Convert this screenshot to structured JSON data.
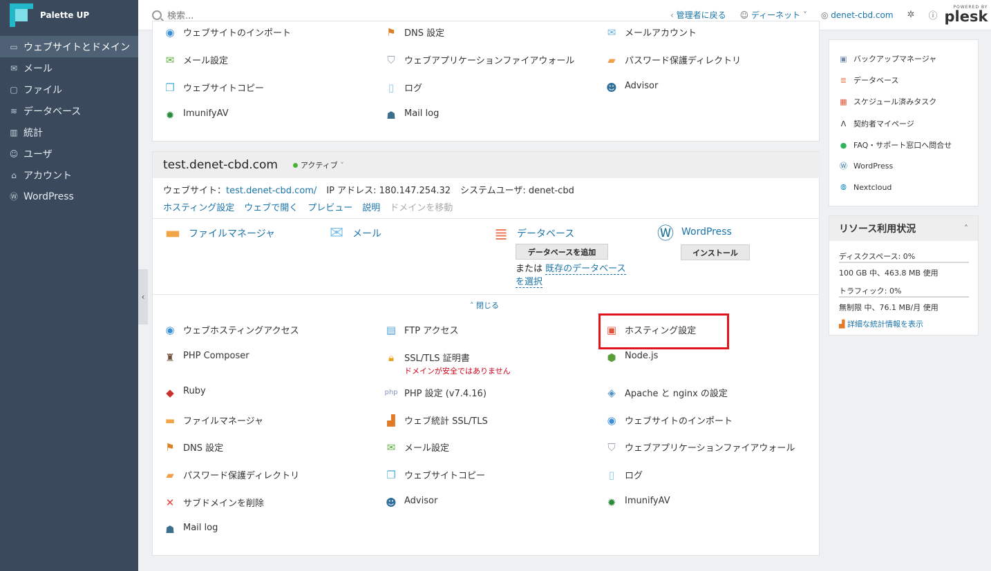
{
  "app": {
    "title": "Palette UP"
  },
  "sidebar": {
    "items": [
      {
        "label": "ウェブサイトとドメイン",
        "icon": "monitor-icon"
      },
      {
        "label": "メール",
        "icon": "mail-icon"
      },
      {
        "label": "ファイル",
        "icon": "folder-icon"
      },
      {
        "label": "データベース",
        "icon": "database-icon"
      },
      {
        "label": "統計",
        "icon": "chart-icon"
      },
      {
        "label": "ユーザ",
        "icon": "user-icon"
      },
      {
        "label": "アカウント",
        "icon": "account-icon"
      },
      {
        "label": "WordPress",
        "icon": "wordpress-icon"
      }
    ]
  },
  "topbar": {
    "search_placeholder": "検索...",
    "back_admin": "管理者に戻る",
    "user": "ディーネット",
    "domain": "denet-cbd.com",
    "powered_by": "POWERED BY",
    "brand": "plesk"
  },
  "top_tools": [
    {
      "label": "ウェブサイトのインポート",
      "icon": "globe-import-icon"
    },
    {
      "label": "DNS 設定",
      "icon": "dns-icon"
    },
    {
      "label": "メールアカウント",
      "icon": "mail-account-icon"
    },
    {
      "label": "メール設定",
      "icon": "mail-settings-icon"
    },
    {
      "label": "ウェブアプリケーションファイアウォール",
      "icon": "shield-icon"
    },
    {
      "label": "パスワード保護ディレクトリ",
      "icon": "lock-folder-icon"
    },
    {
      "label": "ウェブサイトコピー",
      "icon": "copy-icon"
    },
    {
      "label": "ログ",
      "icon": "log-icon"
    },
    {
      "label": "Advisor",
      "icon": "advisor-icon"
    },
    {
      "label": "ImunifyAV",
      "icon": "imunify-icon"
    },
    {
      "label": "Mail log",
      "icon": "mail-log-icon"
    }
  ],
  "site": {
    "name": "test.denet-cbd.com",
    "status": "アクティブ",
    "website_label": "ウェブサイト：",
    "website_link": "test.denet-cbd.com/",
    "ip_label": "IP アドレス: 180.147.254.32",
    "sysuser_label": "システムユーザ: denet-cbd",
    "actions": [
      "ホスティング設定",
      "ウェブで開く",
      "プレビュー",
      "説明",
      "ドメインを移動"
    ],
    "quick": {
      "files": "ファイルマネージャ",
      "mail": "メール",
      "database": "データベース",
      "add_db": "データベースを追加",
      "or_text": "または",
      "existing_db": "既存のデータベース",
      "select_text": "を選択",
      "wordpress": "WordPress",
      "install": "インストール"
    },
    "close_label": "閉じる"
  },
  "tools": [
    {
      "label": "ウェブホスティングアクセス",
      "icon": "globe-user-icon"
    },
    {
      "label": "FTP アクセス",
      "icon": "ftp-icon"
    },
    {
      "label": "ホスティング設定",
      "icon": "hosting-settings-icon"
    },
    {
      "label": "PHP Composer",
      "icon": "composer-icon"
    },
    {
      "label": "SSL/TLS 証明書",
      "icon": "ssl-lock-icon",
      "sub": "ドメインが安全ではありません"
    },
    {
      "label": "Node.js",
      "icon": "nodejs-icon"
    },
    {
      "label": "Ruby",
      "icon": "ruby-icon"
    },
    {
      "label": "PHP 設定 (v7.4.16)",
      "icon": "php-icon"
    },
    {
      "label": "Apache と nginx の設定",
      "icon": "apache-icon"
    },
    {
      "label": "ファイルマネージャ",
      "icon": "folder-icon"
    },
    {
      "label": "ウェブ統計 SSL/TLS",
      "icon": "stats-icon"
    },
    {
      "label": "ウェブサイトのインポート",
      "icon": "globe-import-icon"
    },
    {
      "label": "DNS 設定",
      "icon": "dns-icon"
    },
    {
      "label": "メール設定",
      "icon": "mail-settings-icon"
    },
    {
      "label": "ウェブアプリケーションファイアウォール",
      "icon": "shield-icon"
    },
    {
      "label": "パスワード保護ディレクトリ",
      "icon": "lock-folder-icon"
    },
    {
      "label": "ウェブサイトコピー",
      "icon": "copy-icon"
    },
    {
      "label": "ログ",
      "icon": "log-icon"
    },
    {
      "label": "サブドメインを削除",
      "icon": "delete-icon"
    },
    {
      "label": "Advisor",
      "icon": "advisor-icon"
    },
    {
      "label": "ImunifyAV",
      "icon": "imunify-icon"
    },
    {
      "label": "Mail log",
      "icon": "mail-log-icon"
    }
  ],
  "right_panel": {
    "links": [
      {
        "label": "バックアップマネージャ",
        "icon": "backup-icon"
      },
      {
        "label": "データベース",
        "icon": "database-icon"
      },
      {
        "label": "スケジュール済みタスク",
        "icon": "calendar-icon"
      },
      {
        "label": "契約者マイページ",
        "icon": "mypage-icon"
      },
      {
        "label": "FAQ・サポート窓口へ問合せ",
        "icon": "support-icon"
      },
      {
        "label": "WordPress",
        "icon": "wordpress-icon"
      },
      {
        "label": "Nextcloud",
        "icon": "nextcloud-icon"
      }
    ],
    "resources": {
      "title": "リソース利用状況",
      "disk_label": "ディスクスペース: 0%",
      "disk_value": 0,
      "disk_detail": "100 GB 中、463.8 MB 使用",
      "traffic_label": "トラフィック: 0%",
      "traffic_value": 0,
      "traffic_detail": "無制限 中、76.1 MB/月 使用",
      "stats_link": "詳細な統計情報を表示"
    }
  },
  "colors": {
    "sidebar": "#3a4a5c",
    "link": "#1a73a8",
    "highlight": "#e0131d",
    "status": "#4caf3a"
  }
}
